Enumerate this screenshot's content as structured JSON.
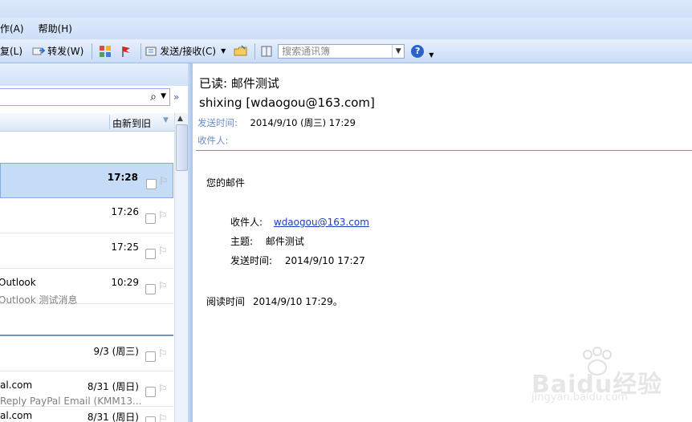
{
  "menu": {
    "items": [
      {
        "label": "操作(A)",
        "visible_text": "作(A)"
      },
      {
        "label": "帮助(H)"
      }
    ]
  },
  "toolbar": {
    "reply_all_fragment": "复(L)",
    "forward_label": "转发(W)",
    "send_receive_label": "发送/接收(C)",
    "search_contacts_placeholder": "搜索通讯簿"
  },
  "message_list": {
    "search_glyph": "⌕",
    "sort_label": "由新到旧",
    "messages": [
      {
        "line1": "",
        "line2": "",
        "time": "17:28",
        "selected": true,
        "bold": true
      },
      {
        "line1": "",
        "line2": "",
        "time": "17:26"
      },
      {
        "line1": "",
        "line2": "",
        "time": "17:25"
      },
      {
        "line1": "Outlook",
        "line2": "Outlook 测试消息",
        "time": "10:29"
      },
      {
        "line1": "",
        "line2": "",
        "time": "9/3 (周三)"
      },
      {
        "line1": "al.com",
        "line2": "Reply PayPal Email  (KMM13...",
        "time": "8/31 (周日)"
      },
      {
        "line1": "al.com",
        "line2": "",
        "time": "8/31 (周日)"
      }
    ]
  },
  "reading_pane": {
    "subject": "已读: 邮件测试",
    "sender": "shixing [wdaogou@163.com]",
    "sent_label": "发送时间:",
    "sent_value": "2014/9/10 (周三) 17:29",
    "to_label": "收件人:",
    "body": {
      "greeting": "您的邮件",
      "recipient_label": "收件人:",
      "recipient_value": "wdaogou@163.com",
      "topic_label": "主题:",
      "topic_value": "邮件测试",
      "sent_label": "发送时间:",
      "sent_value": "2014/9/10 17:27",
      "read_label": "阅读时间",
      "read_value": "2014/9/10 17:29。"
    }
  },
  "watermark": {
    "brand": "Baidu经验",
    "site": "jingyan.baidu.com"
  },
  "colors": {
    "selected_row": "#c5dcf8",
    "header_label": "#6e8fc4",
    "link": "#1f3fbf"
  }
}
